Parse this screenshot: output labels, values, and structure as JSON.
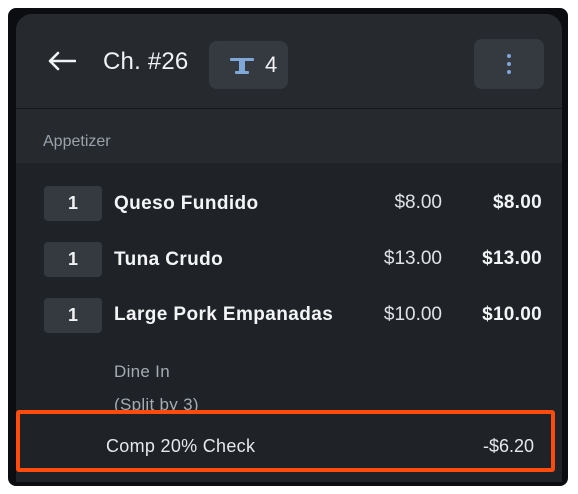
{
  "header": {
    "title": "Ch. #26",
    "table_count": "4"
  },
  "section": {
    "label": "Appetizer"
  },
  "items": [
    {
      "qty": "1",
      "name": "Queso Fundido",
      "unit_price": "$8.00",
      "total": "$8.00"
    },
    {
      "qty": "1",
      "name": "Tuna Crudo",
      "unit_price": "$13.00",
      "total": "$13.00"
    },
    {
      "qty": "1",
      "name": "Large Pork Empanadas",
      "unit_price": "$10.00",
      "total": "$10.00",
      "modifiers": [
        "Dine In",
        "(Split by 3)"
      ]
    }
  ],
  "comp": {
    "label": "Comp 20% Check",
    "amount": "-$6.20"
  },
  "colors": {
    "highlight": "#ff4c0c",
    "icon_blue": "#7fa7d8",
    "background": "#1f2226"
  }
}
